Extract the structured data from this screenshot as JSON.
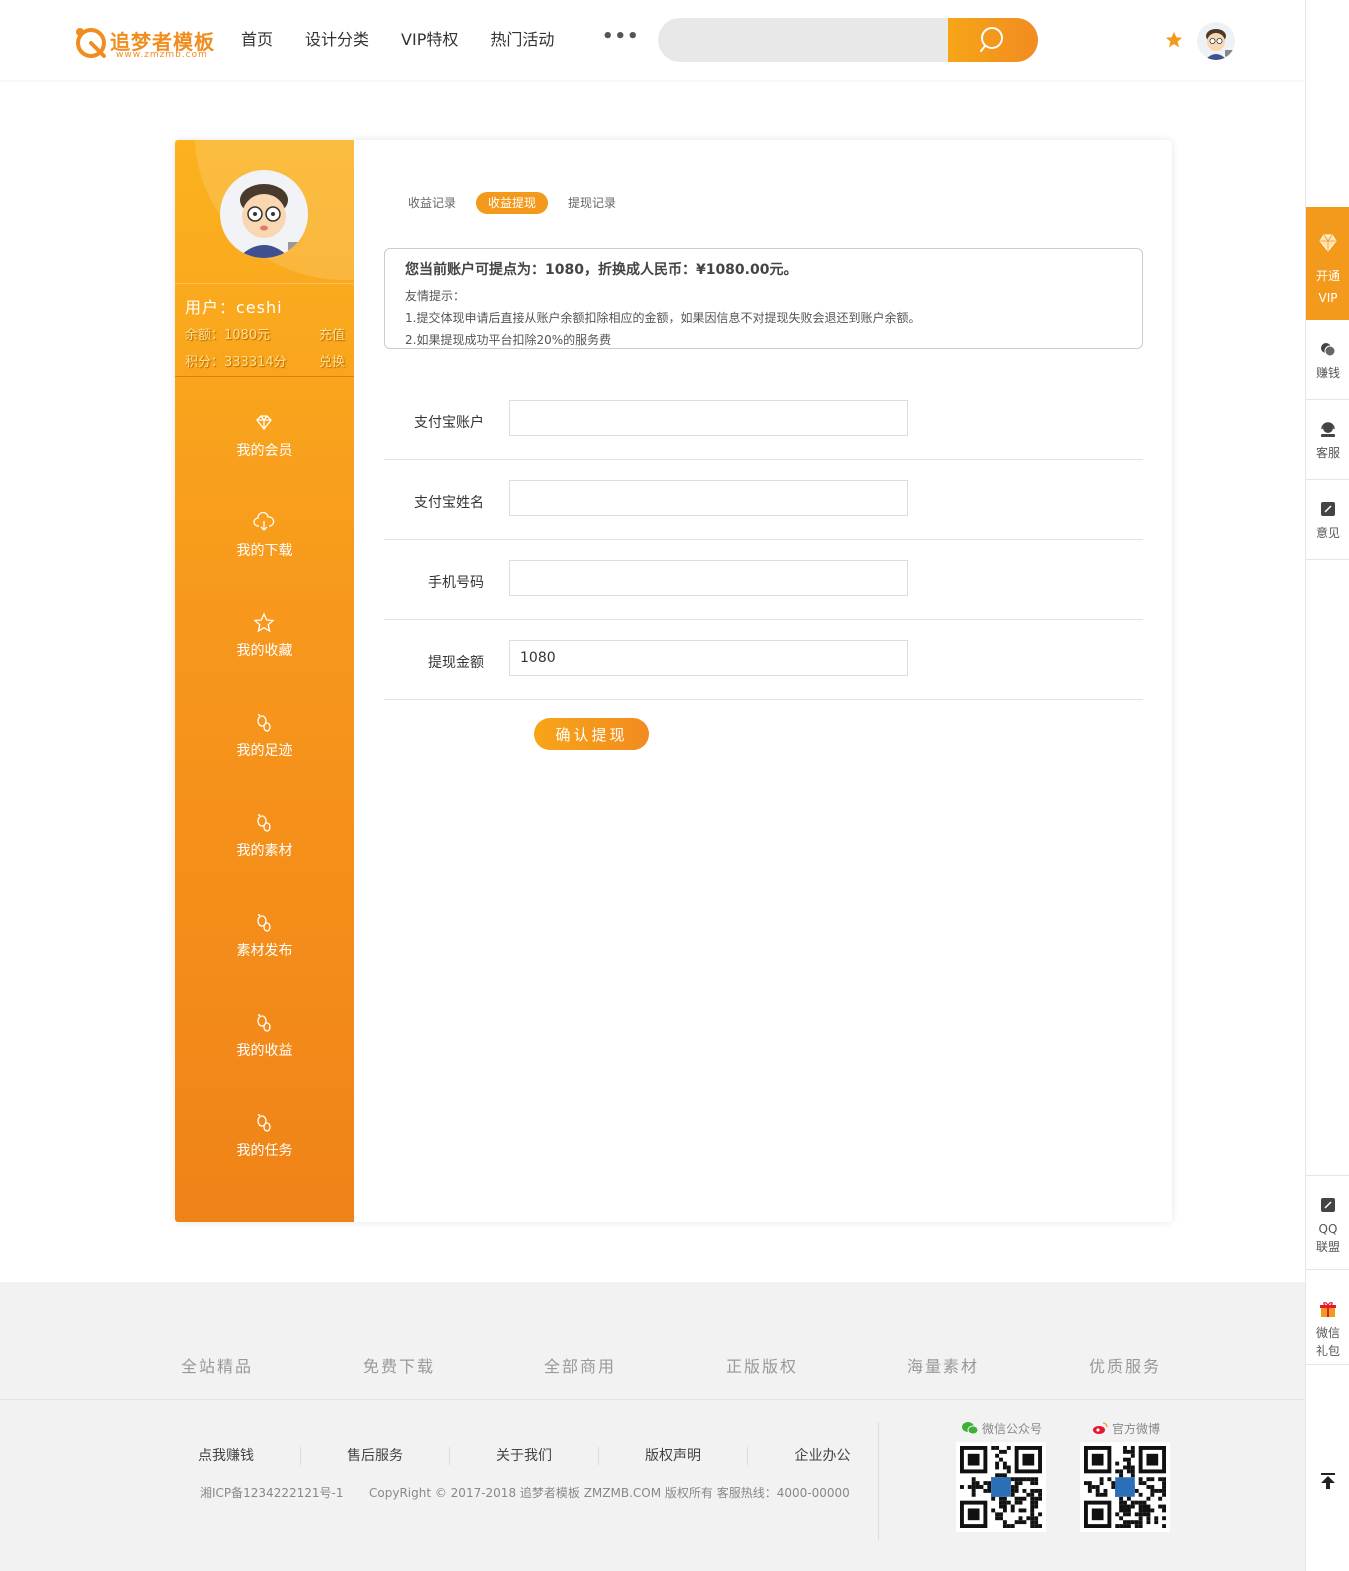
{
  "header": {
    "logo_text": "追梦者模板",
    "logo_sub": "www.zmzmb.com",
    "nav": [
      "首页",
      "设计分类",
      "VIP特权",
      "热门活动"
    ],
    "more": "•••",
    "search_placeholder": ""
  },
  "sidebar": {
    "user_name": "用户：ceshi",
    "balance_label": "余额：1080元",
    "balance_action": "充值",
    "points_label": "积分：333314分",
    "points_action": "兑换",
    "menu": [
      {
        "label": "我的会员",
        "icon": "diamond-icon"
      },
      {
        "label": "我的下载",
        "icon": "cloud-download-icon"
      },
      {
        "label": "我的收藏",
        "icon": "star-icon"
      },
      {
        "label": "我的足迹",
        "icon": "footprint-icon"
      },
      {
        "label": "我的素材",
        "icon": "footprint-icon"
      },
      {
        "label": "素材发布",
        "icon": "footprint-icon"
      },
      {
        "label": "我的收益",
        "icon": "footprint-icon"
      },
      {
        "label": "我的任务",
        "icon": "footprint-icon"
      }
    ]
  },
  "content": {
    "tabs": [
      "收益记录",
      "收益提现",
      "提现记录"
    ],
    "active_tab": 1,
    "notice": {
      "main": "您当前账户可提点为：1080，折换成人民币：¥1080.00元。",
      "tip_title": "友情提示：",
      "tip1": "1.提交体现申请后直接从账户余额扣除相应的金额，如果因信息不对提现失败会退还到账户余额。",
      "tip2": "2.如果提现成功平台扣除20%的服务费"
    },
    "form": {
      "alipay_account_label": "支付宝账户",
      "alipay_account_value": "",
      "alipay_name_label": "支付宝姓名",
      "alipay_name_value": "",
      "phone_label": "手机号码",
      "phone_value": "",
      "amount_label": "提现金额",
      "amount_value": "1080",
      "submit_label": "确认提现"
    }
  },
  "footer": {
    "features": [
      "全站精品",
      "免费下载",
      "全部商用",
      "正版版权",
      "海量素材",
      "优质服务"
    ],
    "links": [
      "点我赚钱",
      "售后服务",
      "关于我们",
      "版权声明",
      "企业办公"
    ],
    "icp": "湘ICP备1234222121号-1",
    "copyright": "CopyRight © 2017-2018 追梦者模板 ZMZMB.COM 版权所有 客服热线：4000-00000",
    "wechat_title": "微信公众号",
    "weibo_title": "官方微博"
  },
  "rightbar": {
    "vip_line1": "开通",
    "vip_line2": "VIP",
    "earn": "赚钱",
    "service": "客服",
    "feedback": "意见",
    "qq_line1": "QQ",
    "qq_line2": "联盟",
    "gift_line1": "微信",
    "gift_line2": "礼包"
  },
  "colors": {
    "accent": "#f39a1d",
    "sidebar_top": "#fbb21e",
    "sidebar_bottom": "#f08318"
  }
}
